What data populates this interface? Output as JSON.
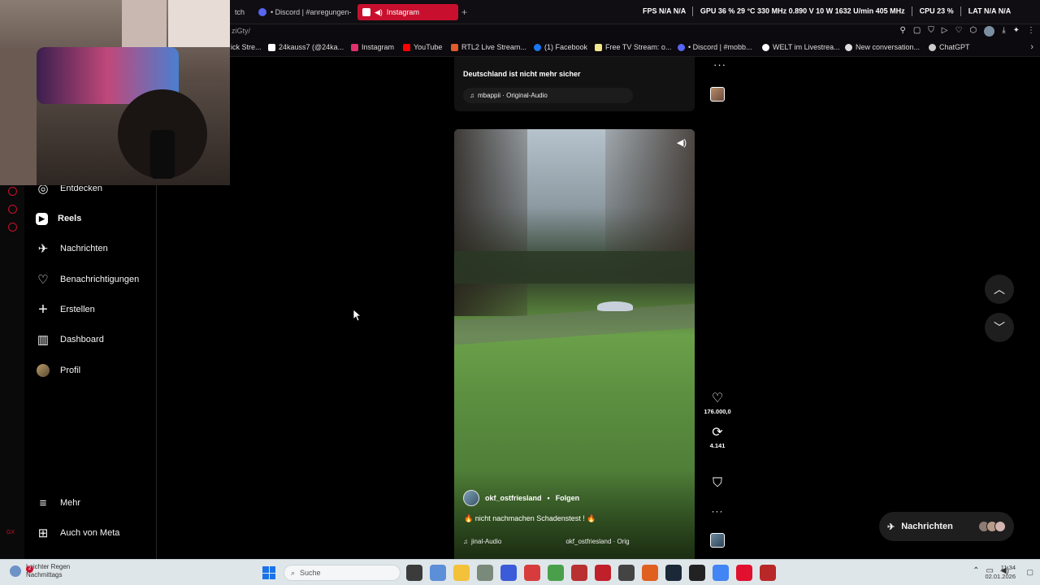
{
  "browser": {
    "tabs": [
      {
        "label": "tch",
        "color": "#6a3fb5",
        "active": false
      },
      {
        "label": "• Discord | #anregungen-",
        "color": "#5865f2",
        "active": false
      },
      {
        "label": "Instagram",
        "color": "#e1306c",
        "active": true
      }
    ],
    "address_fragment": "ziGty/",
    "hud": {
      "fps_label": "FPS",
      "fps_value": "N/A",
      "fps_value2": "N/A",
      "gpu": "GPU 36 % 29 °C 330 MHz 0.890 V 10 W 1632 U/min 405 MHz",
      "cpu": "CPU 23 %",
      "lat": "LAT N/A N/A"
    },
    "bookmarks": [
      {
        "label": "ick Stre...",
        "color": "#888888"
      },
      {
        "label": "24kauss7 (@24ka...",
        "color": "#ffffff"
      },
      {
        "label": "Instagram",
        "color": "#e1306c"
      },
      {
        "label": "YouTube",
        "color": "#ff0000"
      },
      {
        "label": "RTL2 Live Stream...",
        "color": "#e05a2a"
      },
      {
        "label": "(1) Facebook",
        "color": "#1877f2"
      },
      {
        "label": "Free TV Stream: o...",
        "color": "#f0e68c"
      },
      {
        "label": "• Discord | #mobb...",
        "color": "#5865f2"
      },
      {
        "label": "WELT im Livestrea...",
        "color": "#ffffff"
      },
      {
        "label": "New conversation...",
        "color": "#dddddd"
      },
      {
        "label": "ChatGPT",
        "color": "#cccccc"
      }
    ]
  },
  "obs": {
    "label_top": "GX",
    "label_bottom": "GX"
  },
  "sidebar": {
    "items": [
      {
        "label": "Entdecken",
        "icon": "compass-icon",
        "glyph": "◎",
        "bold": false
      },
      {
        "label": "Reels",
        "icon": "reels-icon",
        "glyph": "▶",
        "bold": true
      },
      {
        "label": "Nachrichten",
        "icon": "messages-icon",
        "glyph": "✈",
        "bold": false
      },
      {
        "label": "Benachrichtigungen",
        "icon": "heart-icon",
        "glyph": "♡",
        "bold": false
      },
      {
        "label": "Erstellen",
        "icon": "plus-icon",
        "glyph": "+",
        "bold": false
      },
      {
        "label": "Dashboard",
        "icon": "dashboard-icon",
        "glyph": "▥",
        "bold": false
      },
      {
        "label": "Profil",
        "icon": "avatar",
        "glyph": "",
        "bold": false
      }
    ],
    "bottom": [
      {
        "label": "Mehr",
        "icon": "menu-icon",
        "glyph": "≡"
      },
      {
        "label": "Auch von Meta",
        "icon": "meta-icon",
        "glyph": "⊞"
      }
    ]
  },
  "prev_reel": {
    "caption": "Deutschland ist nicht mehr sicher",
    "audio": "mbappii · Original-Audio"
  },
  "reel": {
    "author": "okf_ostfriesland",
    "dot": "•",
    "follow": "Folgen",
    "caption": "🔥 nicht nachmachen Schadenstest ! 🔥",
    "audio_left": "jinal-Audio",
    "audio_right": "okf_ostfriesland · Orig",
    "likes": "176.000,0",
    "reposts": "4.141"
  },
  "messages_pill": {
    "label": "Nachrichten"
  },
  "taskbar": {
    "weather_line1": "Leichter Regen",
    "weather_line2": "Nachmittags",
    "weather_badge": "2",
    "search_placeholder": "Suche",
    "time": "11:34",
    "date": "02.01.2026"
  }
}
